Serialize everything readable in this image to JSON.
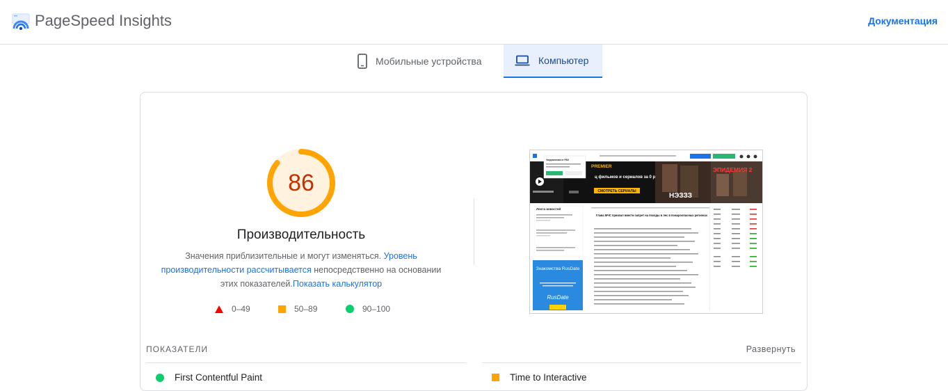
{
  "header": {
    "app_title": "PageSpeed Insights",
    "doc_link": "Документация"
  },
  "tabs": [
    {
      "label": "Мобильные устройства",
      "icon": "smartphone-icon",
      "selected": false
    },
    {
      "label": "Компьютер",
      "icon": "laptop-icon",
      "selected": true
    }
  ],
  "score": {
    "value": "86",
    "fraction": 0.86,
    "color": "#ffa400",
    "text_color": "#c33300",
    "title": "Производительность",
    "desc_prefix": "Значения приблизительные и могут изменяться.",
    "desc_link_1": "Уровень производительности рассчитывается",
    "desc_middle": "непосредственно на основании этих показателей.",
    "desc_link_2": "Показать калькулятор"
  },
  "legend": [
    {
      "range": "0–49",
      "shape": "triangle",
      "color": "#ff0000"
    },
    {
      "range": "50–89",
      "shape": "square",
      "color": "#ffa400"
    },
    {
      "range": "90–100",
      "shape": "circle",
      "color": "#0cce6b"
    }
  ],
  "screenshot": {
    "popup_title": "Уведомления от РБК",
    "popup_text": "Хотите получать уведомления о важных новостях?",
    "popup_accept": "Подписаться",
    "popup_decline": "Не сейчас",
    "banner_brand": "PREMIER",
    "banner_line": "ц фильмов и сериалов за 0 рублей",
    "banner_cta": "СМОТРЕТЬ СЕРИАЛЫ",
    "poster_1": "НЭЗЗЗ",
    "poster_2": "ЭПИДЕМИЯ 2",
    "feed_title": "Лента новостей",
    "headline": "Глава МЧС призвал ввести запрет на походы в лес в пожароопасных регионах",
    "ad_title": "Знакомства RusDate",
    "ad_logo": "RusDate",
    "ad_button": "Перейти"
  },
  "metrics": {
    "section_label": "ПОКАЗАТЕЛИ",
    "expand_label": "Развернуть",
    "items": [
      {
        "name": "First Contentful Paint",
        "status": "good",
        "color": "#0cce6b"
      },
      {
        "name": "Time to Interactive",
        "status": "average",
        "color": "#ffa400"
      }
    ]
  }
}
